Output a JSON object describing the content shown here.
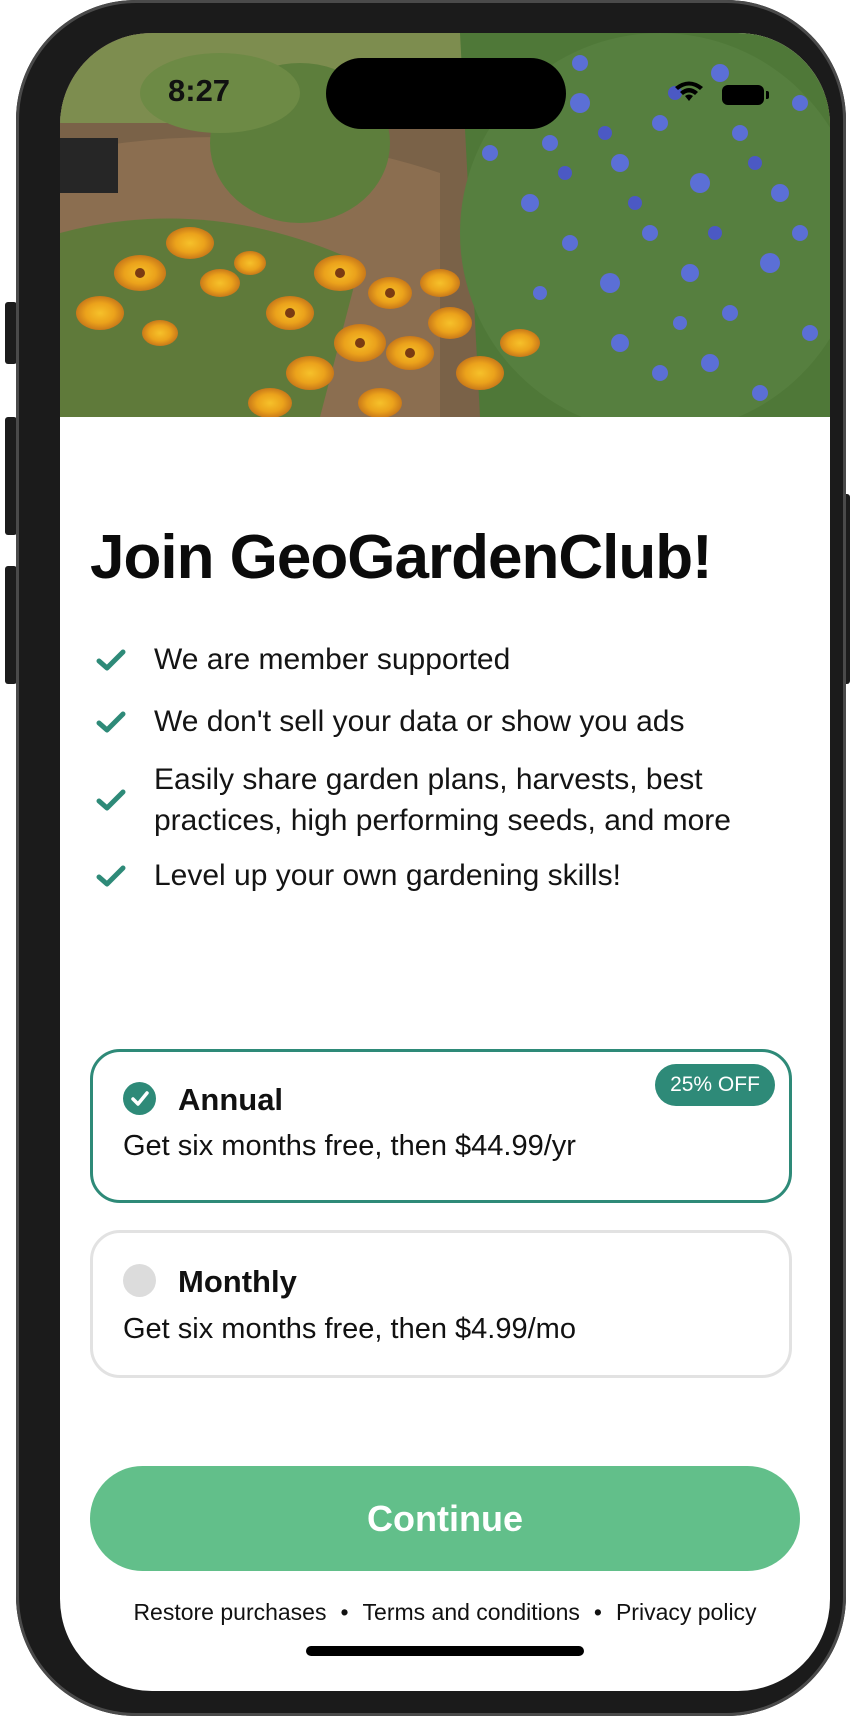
{
  "status_bar": {
    "time": "8:27"
  },
  "title": "Join GeoGardenClub!",
  "features": [
    "We are member supported",
    "We don't sell your data or show you ads",
    "Easily share garden plans, harvests, best practices, high performing seeds, and more",
    "Level up your own gardening skills!"
  ],
  "plans": {
    "annual": {
      "name": "Annual",
      "description": "Get six months free, then $44.99/yr",
      "badge": "25% OFF",
      "selected": true
    },
    "monthly": {
      "name": "Monthly",
      "description": "Get six months free, then $4.99/mo",
      "selected": false
    }
  },
  "continue_label": "Continue",
  "footer": {
    "restore": "Restore purchases",
    "separator": "•",
    "terms": "Terms and conditions",
    "privacy": "Privacy policy"
  },
  "colors": {
    "accent": "#2e8a78",
    "button": "#62bf8a"
  },
  "icons": [
    "wifi-icon",
    "battery-icon",
    "check-icon",
    "radio-checked-icon",
    "radio-unchecked-icon"
  ]
}
